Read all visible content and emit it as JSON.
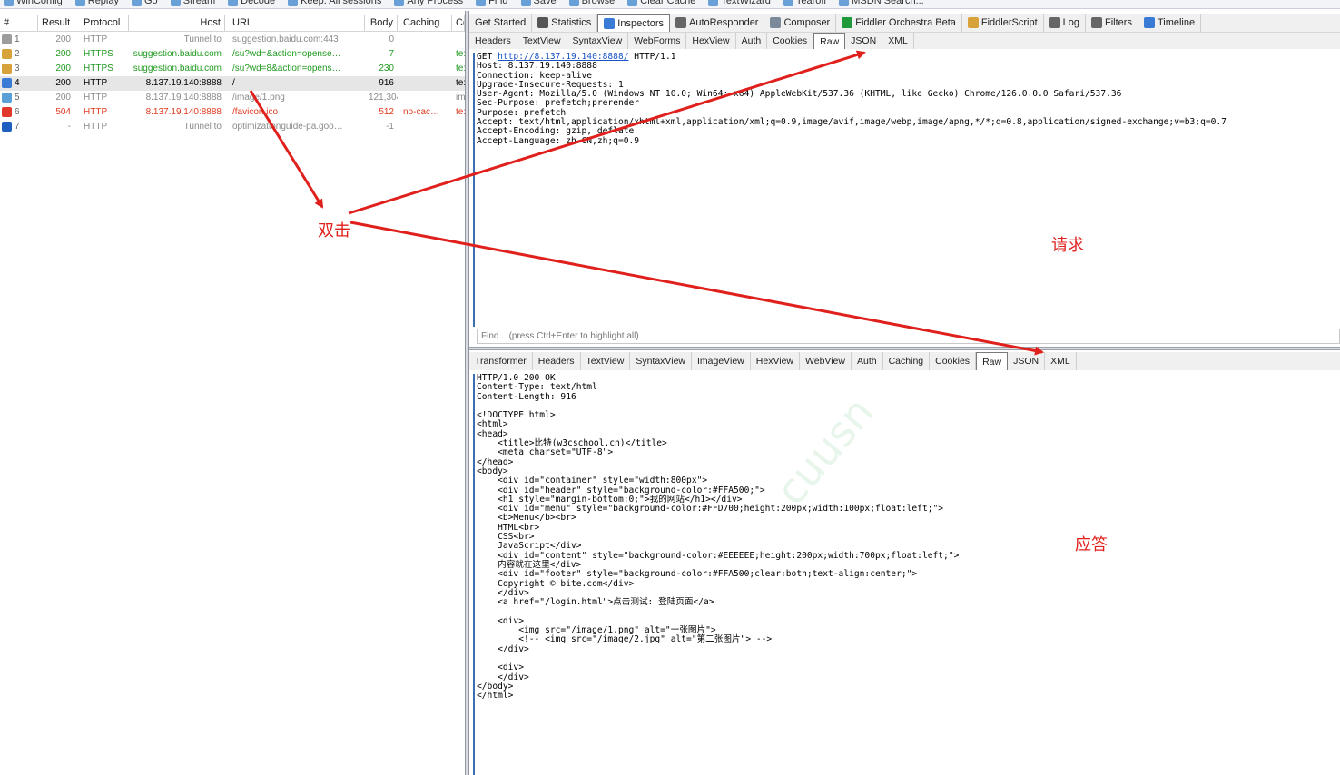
{
  "toolbar": {
    "items": [
      "WinConfig",
      "Replay",
      "Go",
      "Stream",
      "Decode",
      "Keep: All sessions",
      "Any Process",
      "Find",
      "Save",
      "Browse",
      "Clear Cache",
      "TextWizard",
      "Tearoff",
      "MSDN Search..."
    ]
  },
  "sessions": {
    "headers": {
      "num": "#",
      "result": "Result",
      "protocol": "Protocol",
      "host": "Host",
      "url": "URL",
      "body": "Body",
      "caching": "Caching",
      "ctype": "Co"
    },
    "rows": [
      {
        "num": "1",
        "result": "200",
        "protocol": "HTTP",
        "host": "Tunnel to",
        "url": "suggestion.baidu.com:443",
        "body": "0",
        "caching": "",
        "ctype": "",
        "color": "#8a8a8a",
        "icon_color": "#9c9c9c",
        "icon": "lock-icon"
      },
      {
        "num": "2",
        "result": "200",
        "protocol": "HTTPS",
        "host": "suggestion.baidu.com",
        "url": "/su?wd=&action=opense…",
        "body": "7",
        "caching": "",
        "ctype": "te:",
        "color": "#1f9a1f",
        "icon_color": "#d8a23a",
        "icon": "js-file-icon"
      },
      {
        "num": "3",
        "result": "200",
        "protocol": "HTTPS",
        "host": "suggestion.baidu.com",
        "url": "/su?wd=8&action=opens…",
        "body": "230",
        "caching": "",
        "ctype": "te:",
        "color": "#1f9a1f",
        "icon_color": "#d8a23a",
        "icon": "js-file-icon"
      },
      {
        "num": "4",
        "result": "200",
        "protocol": "HTTP",
        "host": "8.137.19.140:8888",
        "url": "/",
        "body": "916",
        "caching": "",
        "ctype": "te:",
        "color": "#000000",
        "icon_color": "#3a7bd5",
        "icon": "html-document-icon",
        "selected": true
      },
      {
        "num": "5",
        "result": "200",
        "protocol": "HTTP",
        "host": "8.137.19.140:8888",
        "url": "/image/1.png",
        "body": "121,304",
        "caching": "",
        "ctype": "im:",
        "color": "#8a8a8a",
        "icon_color": "#5aa0d8",
        "icon": "image-icon"
      },
      {
        "num": "6",
        "result": "504",
        "protocol": "HTTP",
        "host": "8.137.19.140:8888",
        "url": "/favicon.ico",
        "body": "512",
        "caching": "no-cac…",
        "ctype": "te:",
        "color": "#e03a1e",
        "icon_color": "#e0392b",
        "icon": "error-icon"
      },
      {
        "num": "7",
        "result": "-",
        "protocol": "HTTP",
        "host": "Tunnel to",
        "url": "optimizationguide-pa.goo…",
        "body": "-1",
        "caching": "",
        "ctype": "",
        "color": "#8a8a8a",
        "icon_color": "#1e5fbf",
        "icon": "up-arrow-icon"
      }
    ]
  },
  "main_tabs": [
    {
      "label": "Get Started",
      "icon": "",
      "icon_color": ""
    },
    {
      "label": "Statistics",
      "icon": "clock-icon",
      "icon_color": "#555555"
    },
    {
      "label": "Inspectors",
      "icon": "magnifier-icon",
      "icon_color": "#3a7bd5"
    },
    {
      "label": "AutoResponder",
      "icon": "lightning-icon",
      "icon_color": "#666666"
    },
    {
      "label": "Composer",
      "icon": "pencil-icon",
      "icon_color": "#7a8a9a"
    },
    {
      "label": "Fiddler Orchestra Beta",
      "icon": "fo-icon",
      "icon_color": "#1f9a3a"
    },
    {
      "label": "FiddlerScript",
      "icon": "script-icon",
      "icon_color": "#d8a23a"
    },
    {
      "label": "Log",
      "icon": "log-icon",
      "icon_color": "#666666"
    },
    {
      "label": "Filters",
      "icon": "checkbox-icon",
      "icon_color": "#666666"
    },
    {
      "label": "Timeline",
      "icon": "timeline-icon",
      "icon_color": "#3a7bd5"
    }
  ],
  "request_tabs": [
    "Headers",
    "TextView",
    "SyntaxView",
    "WebForms",
    "HexView",
    "Auth",
    "Cookies",
    "Raw",
    "JSON",
    "XML"
  ],
  "request_active": "Raw",
  "request_lines": [
    "Host: 8.137.19.140:8888",
    "Connection: keep-alive",
    "Upgrade-Insecure-Requests: 1",
    "User-Agent: Mozilla/5.0 (Windows NT 10.0; Win64; x64) AppleWebKit/537.36 (KHTML, like Gecko) Chrome/126.0.0.0 Safari/537.36",
    "Sec-Purpose: prefetch;prerender",
    "Purpose: prefetch",
    "Accept: text/html,application/xhtml+xml,application/xml;q=0.9,image/avif,image/webp,image/apng,*/*;q=0.8,application/signed-exchange;v=b3;q=0.7",
    "Accept-Encoding: gzip, deflate",
    "Accept-Language: zh-CN,zh;q=0.9"
  ],
  "request_first": {
    "method": "GET ",
    "url": "http://8.137.19.140:8888/",
    "version": " HTTP/1.1"
  },
  "find_placeholder": "Find... (press Ctrl+Enter to highlight all)",
  "response_tabs": [
    "Transformer",
    "Headers",
    "TextView",
    "SyntaxView",
    "ImageView",
    "HexView",
    "WebView",
    "Auth",
    "Caching",
    "Cookies",
    "Raw",
    "JSON",
    "XML"
  ],
  "response_active": "Raw",
  "response_lines": [
    "HTTP/1.0 200 OK",
    "Content-Type: text/html",
    "Content-Length: 916",
    "",
    "<!DOCTYPE html>",
    "<html>",
    "<head>",
    "    <title>比特(w3cschool.cn)</title>",
    "    <meta charset=\"UTF-8\">",
    "</head>",
    "<body>",
    "    <div id=\"container\" style=\"width:800px\">",
    "    <div id=\"header\" style=\"background-color:#FFA500;\">",
    "    <h1 style=\"margin-bottom:0;\">我的网站</h1></div>",
    "    <div id=\"menu\" style=\"background-color:#FFD700;height:200px;width:100px;float:left;\">",
    "    <b>Menu</b><br>",
    "    HTML<br>",
    "    CSS<br>",
    "    JavaScript</div>",
    "    <div id=\"content\" style=\"background-color:#EEEEEE;height:200px;width:700px;float:left;\">",
    "    内容就在这里</div>",
    "    <div id=\"footer\" style=\"background-color:#FFA500;clear:both;text-align:center;\">",
    "    Copyright © bite.com</div>",
    "    </div>",
    "    <a href=\"/login.html\">点击测试: 登陆页面</a>",
    "",
    "    <div>",
    "        <img src=\"/image/1.png\" alt=\"一张图片\">",
    "        <!-- <img src=\"/image/2.jpg\" alt=\"第二张图片\"> -->",
    "    </div>",
    "",
    "    <div>",
    "    </div>",
    "</body>",
    "</html>"
  ],
  "annotations": {
    "double_click": "双击",
    "request": "请求",
    "response": "应答"
  },
  "watermark": "cuusn",
  "accent_red": "#e0201c"
}
